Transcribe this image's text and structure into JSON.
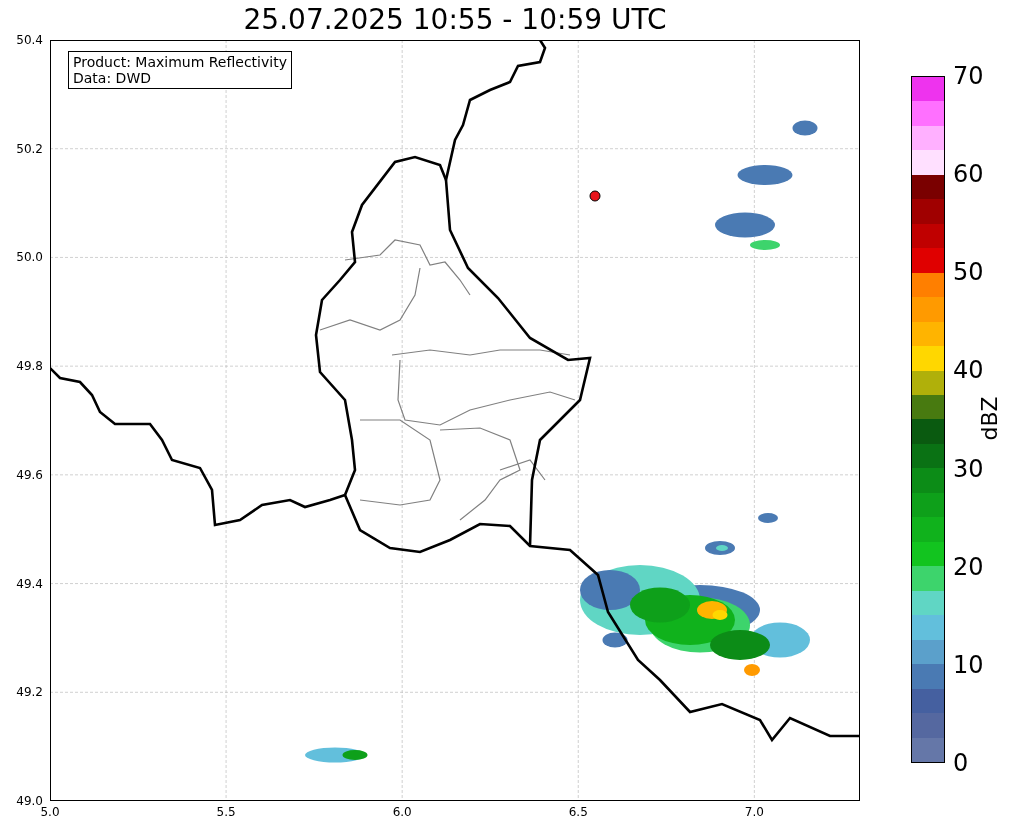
{
  "title": "25.07.2025 10:55 - 10:59 UTC",
  "legend": {
    "lines": [
      "Product: Maximum Reflectivity",
      "Data: DWD"
    ]
  },
  "map": {
    "xticks": [
      "5.0",
      "5.5",
      "6.0",
      "6.5",
      "7.0"
    ],
    "yticks": [
      "50.4",
      "50.2",
      "50.0",
      "49.8",
      "49.6",
      "49.4",
      "49.2",
      "49.0"
    ]
  },
  "colorbar": {
    "label": "dBZ",
    "ticks": [
      "70",
      "60",
      "50",
      "40",
      "30",
      "20",
      "10",
      "0"
    ],
    "segments": [
      {
        "color": "#6577a8"
      },
      {
        "color": "#5568a0"
      },
      {
        "color": "#4560a0"
      },
      {
        "color": "#4a7ab3"
      },
      {
        "color": "#5ba0cb"
      },
      {
        "color": "#62bfdc"
      },
      {
        "color": "#60d6c4"
      },
      {
        "color": "#3dd46c"
      },
      {
        "color": "#12c41f"
      },
      {
        "color": "#10b21c"
      },
      {
        "color": "#0ea01a"
      },
      {
        "color": "#0c8c17"
      },
      {
        "color": "#0a7214"
      },
      {
        "color": "#0a5a10"
      },
      {
        "color": "#487a10"
      },
      {
        "color": "#b0b00a"
      },
      {
        "color": "#ffd700"
      },
      {
        "color": "#ffb400"
      },
      {
        "color": "#ff9a00"
      },
      {
        "color": "#ff7f00"
      },
      {
        "color": "#e00000"
      },
      {
        "color": "#c00000"
      },
      {
        "color": "#a00000"
      },
      {
        "color": "#7a0000"
      },
      {
        "color": "#ffe0ff"
      },
      {
        "color": "#ffb0ff"
      },
      {
        "color": "#ff70ff"
      },
      {
        "color": "#ee33ee"
      }
    ]
  }
}
